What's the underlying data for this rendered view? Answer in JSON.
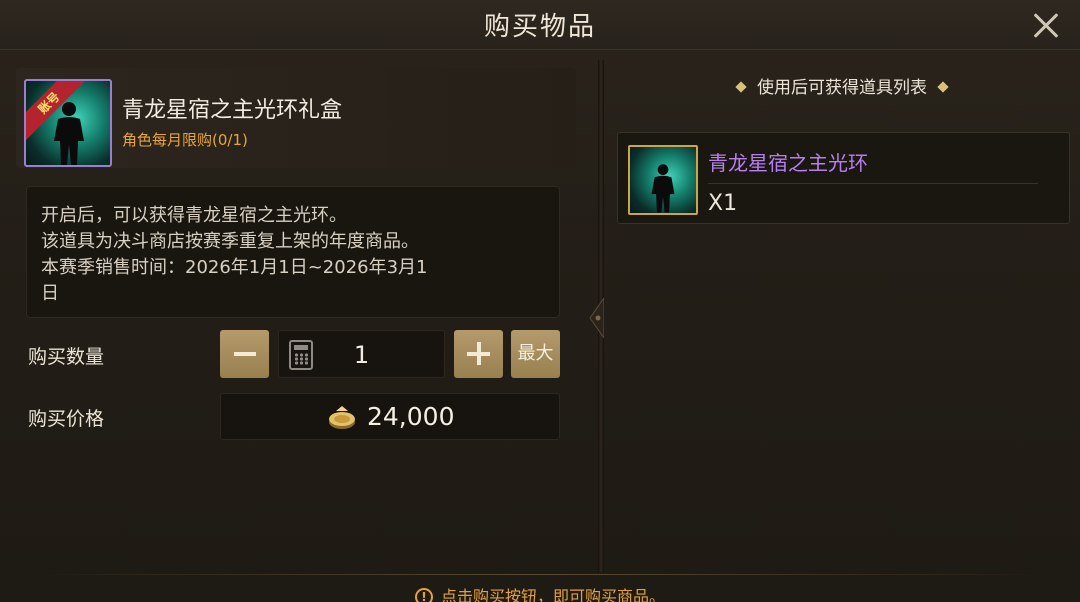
{
  "window": {
    "title": "购买物品"
  },
  "item": {
    "name": "青龙星宿之主光环礼盒",
    "ribbon": "账号",
    "limit": "角色每月限购(0/1)",
    "description": [
      "开启后，可以获得青龙星宿之主光环。",
      "该道具为决斗商店按赛季重复上架的年度商品。",
      "本赛季销售时间：2026年1月1日~2026年3月1",
      "日"
    ],
    "rarity_color": "#9a7fd0"
  },
  "purchase": {
    "quantity_label": "购买数量",
    "quantity_value": "1",
    "max_label": "最大",
    "price_label": "购买价格",
    "price_value": "24,000",
    "currency_icon": "gold-coin-icon"
  },
  "rewards": {
    "header": "使用后可获得道具列表",
    "items": [
      {
        "name": "青龙星宿之主光环",
        "count": "X1",
        "name_color": "#b77ff0"
      }
    ]
  },
  "footer": {
    "note": "点击购买按钮，即可购买商品。"
  },
  "colors": {
    "accent_gold": "#b59a6c",
    "limit_orange": "#e9a53a",
    "epic_purple": "#b77ff0"
  }
}
